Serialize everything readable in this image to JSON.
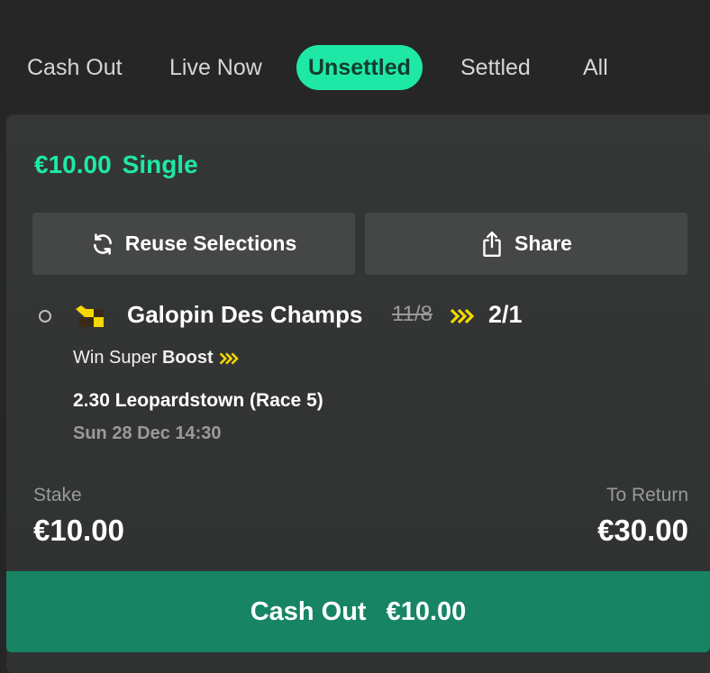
{
  "tabs": [
    {
      "label": "Cash Out"
    },
    {
      "label": "Live Now"
    },
    {
      "label": "Unsettled",
      "active": true
    },
    {
      "label": "Settled"
    },
    {
      "label": "All"
    }
  ],
  "bet": {
    "stake_amount": "€10.00",
    "type": "Single",
    "reuse_label": "Reuse Selections",
    "share_label": "Share",
    "selection": {
      "horse": "Galopin Des Champs",
      "old_odds": "11/8",
      "new_odds": "2/1",
      "market_prefix": "Win Super",
      "market_boost": "Boost",
      "event": "2.30 Leopardstown (Race 5)",
      "time": "Sun 28 Dec 14:30"
    },
    "stake_label": "Stake",
    "stake_value": "€10.00",
    "return_label": "To Return",
    "return_value": "€30.00",
    "cashout_label": "Cash Out",
    "cashout_value": "€10.00"
  },
  "colors": {
    "accent": "#1fe8a6",
    "cashout_bg": "#178563",
    "boost": "#f5d800",
    "background": "#262626"
  },
  "icons": [
    "refresh-icon",
    "share-icon",
    "boost-arrows-icon",
    "jockey-silks-icon"
  ]
}
